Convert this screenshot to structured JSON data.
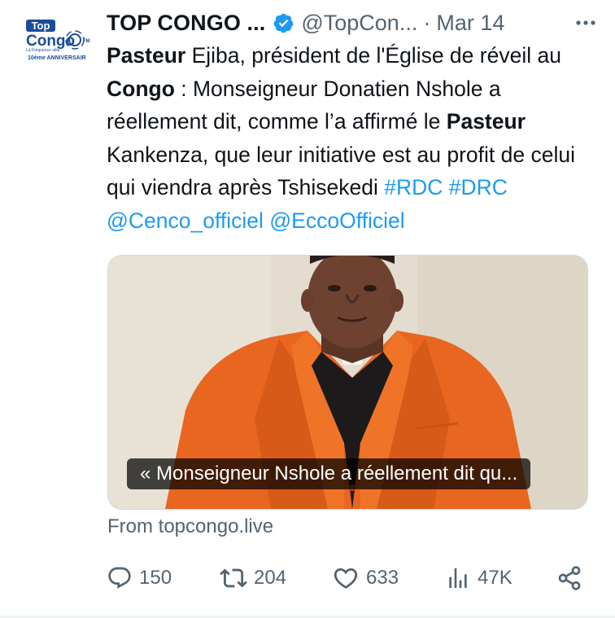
{
  "account": {
    "display_name": "TOP CONGO ...",
    "handle": "@TopCon...",
    "separator": "·",
    "date": "Mar 14",
    "avatar": {
      "logo_top": "Top",
      "logo_main": "Congo",
      "logo_fm": "FM",
      "logo_tagline": "La Fréquence utile",
      "logo_anniversary": "10ème ANNIVERSAIR"
    },
    "verified_icon": "verified-badge-icon",
    "more_icon": "more-dots-icon"
  },
  "tweet": {
    "segments": [
      {
        "text": "Pasteur",
        "style": "bold"
      },
      {
        "text": " Ejiba, président de l'Église de réveil au ",
        "style": "plain"
      },
      {
        "text": "Congo",
        "style": "bold"
      },
      {
        "text": " : Monseigneur Donatien Nshole a réellement dit, comme l’a affirmé le ",
        "style": "plain"
      },
      {
        "text": "Pasteur",
        "style": "bold"
      },
      {
        "text": " Kankenza, que leur initiative est au profit de celui qui viendra après Tshisekedi ",
        "style": "plain"
      },
      {
        "text": "#RDC",
        "style": "link"
      },
      {
        "text": " ",
        "style": "plain"
      },
      {
        "text": "#DRC",
        "style": "link"
      },
      {
        "text": " ",
        "style": "plain"
      },
      {
        "text": "@Cenco_officiel",
        "style": "link"
      },
      {
        "text": " ",
        "style": "plain"
      },
      {
        "text": "@EccoOfficiel",
        "style": "link"
      }
    ]
  },
  "card": {
    "caption": "« Monseigneur Nshole a réellement dit qu...",
    "source": "From topcongo.live"
  },
  "actions": {
    "reply": {
      "icon": "reply-icon",
      "count": "150"
    },
    "retweet": {
      "icon": "retweet-icon",
      "count": "204"
    },
    "like": {
      "icon": "heart-icon",
      "count": "633"
    },
    "views": {
      "icon": "views-chart-icon",
      "count": "47K"
    },
    "share": {
      "icon": "share-icon"
    }
  },
  "colors": {
    "text": "#0f1419",
    "secondary": "#536471",
    "link": "#1d9bf0",
    "jacket": "#e8661f",
    "border": "#cfd9de"
  }
}
